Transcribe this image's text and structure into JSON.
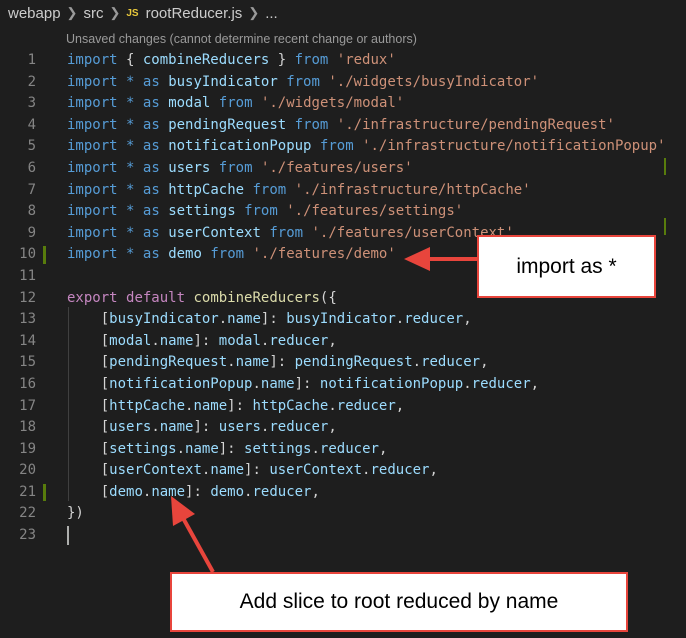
{
  "breadcrumb": {
    "items": [
      "webapp",
      "src"
    ],
    "file_badge": "JS",
    "file_name": "rootReducer.js",
    "more": "..."
  },
  "codelens": "Unsaved changes (cannot determine recent change or authors)",
  "code_lines": [
    {
      "n": "1",
      "tokens": [
        [
          "kw",
          "import"
        ],
        [
          "p",
          " { "
        ],
        [
          "var",
          "combineReducers"
        ],
        [
          "p",
          " } "
        ],
        [
          "kw",
          "from"
        ],
        [
          "p",
          " "
        ],
        [
          "str",
          "'redux'"
        ]
      ]
    },
    {
      "n": "2",
      "tokens": [
        [
          "kw",
          "import"
        ],
        [
          "p",
          " "
        ],
        [
          "kw",
          "*"
        ],
        [
          "p",
          " "
        ],
        [
          "kw",
          "as"
        ],
        [
          "p",
          " "
        ],
        [
          "var",
          "busyIndicator"
        ],
        [
          "p",
          " "
        ],
        [
          "kw",
          "from"
        ],
        [
          "p",
          " "
        ],
        [
          "str",
          "'./widgets/busyIndicator'"
        ]
      ]
    },
    {
      "n": "3",
      "tokens": [
        [
          "kw",
          "import"
        ],
        [
          "p",
          " "
        ],
        [
          "kw",
          "*"
        ],
        [
          "p",
          " "
        ],
        [
          "kw",
          "as"
        ],
        [
          "p",
          " "
        ],
        [
          "var",
          "modal"
        ],
        [
          "p",
          " "
        ],
        [
          "kw",
          "from"
        ],
        [
          "p",
          " "
        ],
        [
          "str",
          "'./widgets/modal'"
        ]
      ]
    },
    {
      "n": "4",
      "tokens": [
        [
          "kw",
          "import"
        ],
        [
          "p",
          " "
        ],
        [
          "kw",
          "*"
        ],
        [
          "p",
          " "
        ],
        [
          "kw",
          "as"
        ],
        [
          "p",
          " "
        ],
        [
          "var",
          "pendingRequest"
        ],
        [
          "p",
          " "
        ],
        [
          "kw",
          "from"
        ],
        [
          "p",
          " "
        ],
        [
          "str",
          "'./infrastructure/pendingRequest'"
        ]
      ]
    },
    {
      "n": "5",
      "tokens": [
        [
          "kw",
          "import"
        ],
        [
          "p",
          " "
        ],
        [
          "kw",
          "*"
        ],
        [
          "p",
          " "
        ],
        [
          "kw",
          "as"
        ],
        [
          "p",
          " "
        ],
        [
          "var",
          "notificationPopup"
        ],
        [
          "p",
          " "
        ],
        [
          "kw",
          "from"
        ],
        [
          "p",
          " "
        ],
        [
          "str",
          "'./infrastructure/notificationPopup'"
        ]
      ]
    },
    {
      "n": "6",
      "tokens": [
        [
          "kw",
          "import"
        ],
        [
          "p",
          " "
        ],
        [
          "kw",
          "*"
        ],
        [
          "p",
          " "
        ],
        [
          "kw",
          "as"
        ],
        [
          "p",
          " "
        ],
        [
          "var",
          "users"
        ],
        [
          "p",
          " "
        ],
        [
          "kw",
          "from"
        ],
        [
          "p",
          " "
        ],
        [
          "str",
          "'./features/users'"
        ]
      ]
    },
    {
      "n": "7",
      "tokens": [
        [
          "kw",
          "import"
        ],
        [
          "p",
          " "
        ],
        [
          "kw",
          "*"
        ],
        [
          "p",
          " "
        ],
        [
          "kw",
          "as"
        ],
        [
          "p",
          " "
        ],
        [
          "var",
          "httpCache"
        ],
        [
          "p",
          " "
        ],
        [
          "kw",
          "from"
        ],
        [
          "p",
          " "
        ],
        [
          "str",
          "'./infrastructure/httpCache'"
        ]
      ]
    },
    {
      "n": "8",
      "tokens": [
        [
          "kw",
          "import"
        ],
        [
          "p",
          " "
        ],
        [
          "kw",
          "*"
        ],
        [
          "p",
          " "
        ],
        [
          "kw",
          "as"
        ],
        [
          "p",
          " "
        ],
        [
          "var",
          "settings"
        ],
        [
          "p",
          " "
        ],
        [
          "kw",
          "from"
        ],
        [
          "p",
          " "
        ],
        [
          "str",
          "'./features/settings'"
        ]
      ]
    },
    {
      "n": "9",
      "tokens": [
        [
          "kw",
          "import"
        ],
        [
          "p",
          " "
        ],
        [
          "kw",
          "*"
        ],
        [
          "p",
          " "
        ],
        [
          "kw",
          "as"
        ],
        [
          "p",
          " "
        ],
        [
          "var",
          "userContext"
        ],
        [
          "p",
          " "
        ],
        [
          "kw",
          "from"
        ],
        [
          "p",
          " "
        ],
        [
          "str",
          "'./features/userContext'"
        ]
      ]
    },
    {
      "n": "10",
      "changed": true,
      "tokens": [
        [
          "kw",
          "import"
        ],
        [
          "p",
          " "
        ],
        [
          "kw",
          "*"
        ],
        [
          "p",
          " "
        ],
        [
          "kw",
          "as"
        ],
        [
          "p",
          " "
        ],
        [
          "var",
          "demo"
        ],
        [
          "p",
          " "
        ],
        [
          "kw",
          "from"
        ],
        [
          "p",
          " "
        ],
        [
          "str",
          "'./features/demo'"
        ]
      ]
    },
    {
      "n": "11",
      "tokens": []
    },
    {
      "n": "12",
      "tokens": [
        [
          "ctl",
          "export"
        ],
        [
          "p",
          " "
        ],
        [
          "ctl",
          "default"
        ],
        [
          "p",
          " "
        ],
        [
          "fn",
          "combineReducers"
        ],
        [
          "p",
          "({"
        ]
      ]
    },
    {
      "n": "13",
      "tokens": [
        [
          "p",
          "    ["
        ],
        [
          "var",
          "busyIndicator"
        ],
        [
          "p",
          "."
        ],
        [
          "var",
          "name"
        ],
        [
          "p",
          "]: "
        ],
        [
          "var",
          "busyIndicator"
        ],
        [
          "p",
          "."
        ],
        [
          "var",
          "reducer"
        ],
        [
          "p",
          ","
        ]
      ]
    },
    {
      "n": "14",
      "tokens": [
        [
          "p",
          "    ["
        ],
        [
          "var",
          "modal"
        ],
        [
          "p",
          "."
        ],
        [
          "var",
          "name"
        ],
        [
          "p",
          "]: "
        ],
        [
          "var",
          "modal"
        ],
        [
          "p",
          "."
        ],
        [
          "var",
          "reducer"
        ],
        [
          "p",
          ","
        ]
      ]
    },
    {
      "n": "15",
      "tokens": [
        [
          "p",
          "    ["
        ],
        [
          "var",
          "pendingRequest"
        ],
        [
          "p",
          "."
        ],
        [
          "var",
          "name"
        ],
        [
          "p",
          "]: "
        ],
        [
          "var",
          "pendingRequest"
        ],
        [
          "p",
          "."
        ],
        [
          "var",
          "reducer"
        ],
        [
          "p",
          ","
        ]
      ]
    },
    {
      "n": "16",
      "tokens": [
        [
          "p",
          "    ["
        ],
        [
          "var",
          "notificationPopup"
        ],
        [
          "p",
          "."
        ],
        [
          "var",
          "name"
        ],
        [
          "p",
          "]: "
        ],
        [
          "var",
          "notificationPopup"
        ],
        [
          "p",
          "."
        ],
        [
          "var",
          "reducer"
        ],
        [
          "p",
          ","
        ]
      ]
    },
    {
      "n": "17",
      "tokens": [
        [
          "p",
          "    ["
        ],
        [
          "var",
          "httpCache"
        ],
        [
          "p",
          "."
        ],
        [
          "var",
          "name"
        ],
        [
          "p",
          "]: "
        ],
        [
          "var",
          "httpCache"
        ],
        [
          "p",
          "."
        ],
        [
          "var",
          "reducer"
        ],
        [
          "p",
          ","
        ]
      ]
    },
    {
      "n": "18",
      "tokens": [
        [
          "p",
          "    ["
        ],
        [
          "var",
          "users"
        ],
        [
          "p",
          "."
        ],
        [
          "var",
          "name"
        ],
        [
          "p",
          "]: "
        ],
        [
          "var",
          "users"
        ],
        [
          "p",
          "."
        ],
        [
          "var",
          "reducer"
        ],
        [
          "p",
          ","
        ]
      ]
    },
    {
      "n": "19",
      "tokens": [
        [
          "p",
          "    ["
        ],
        [
          "var",
          "settings"
        ],
        [
          "p",
          "."
        ],
        [
          "var",
          "name"
        ],
        [
          "p",
          "]: "
        ],
        [
          "var",
          "settings"
        ],
        [
          "p",
          "."
        ],
        [
          "var",
          "reducer"
        ],
        [
          "p",
          ","
        ]
      ]
    },
    {
      "n": "20",
      "tokens": [
        [
          "p",
          "    ["
        ],
        [
          "var",
          "userContext"
        ],
        [
          "p",
          "."
        ],
        [
          "var",
          "name"
        ],
        [
          "p",
          "]: "
        ],
        [
          "var",
          "userContext"
        ],
        [
          "p",
          "."
        ],
        [
          "var",
          "reducer"
        ],
        [
          "p",
          ","
        ]
      ]
    },
    {
      "n": "21",
      "changed": true,
      "tokens": [
        [
          "p",
          "    ["
        ],
        [
          "var",
          "demo"
        ],
        [
          "p",
          "."
        ],
        [
          "var",
          "name"
        ],
        [
          "p",
          "]: "
        ],
        [
          "var",
          "demo"
        ],
        [
          "p",
          "."
        ],
        [
          "var",
          "reducer"
        ],
        [
          "p",
          ","
        ]
      ]
    },
    {
      "n": "22",
      "tokens": [
        [
          "p",
          "})"
        ]
      ]
    },
    {
      "n": "23",
      "tokens": []
    }
  ],
  "callouts": {
    "import_as": "import as *",
    "add_slice": "Add slice to root reduced by name"
  },
  "colors": {
    "background": "#1e1e1e",
    "keyword": "#569cd6",
    "control_keyword": "#c586c0",
    "variable": "#9cdcfe",
    "function": "#dcdcaa",
    "string": "#ce9178",
    "gutter_added": "#587c0c",
    "callout_border": "#e8453c"
  }
}
